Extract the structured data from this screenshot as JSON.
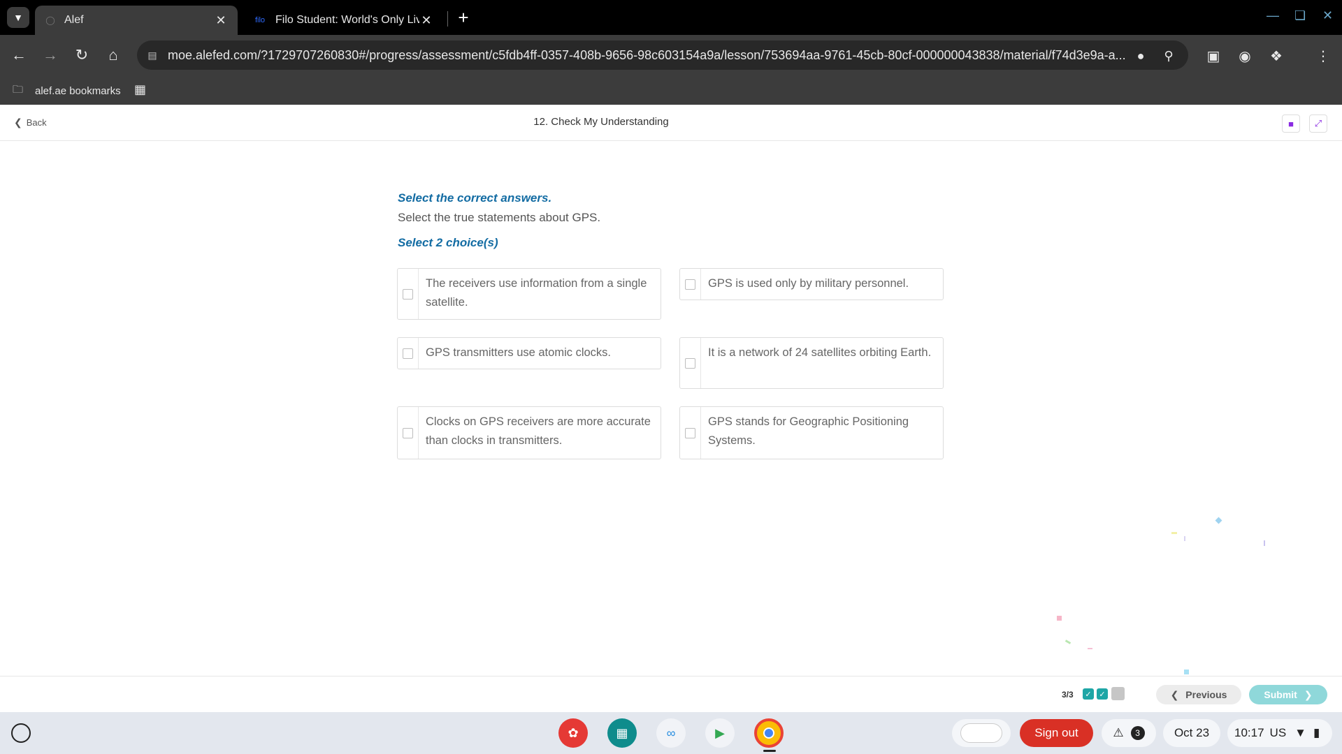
{
  "browser": {
    "tabs": [
      {
        "title": "Alef",
        "favicon": "alef-logo",
        "active": true
      },
      {
        "title": "Filo Student: World's Only Live I",
        "favicon_text": "filo",
        "active": false
      }
    ],
    "url": "moe.alefed.com/?1729707260830#/progress/assessment/c5fdb4ff-0357-408b-9656-98c603154a9a/lesson/753694aa-9761-45cb-80cf-000000043838/material/f74d3e9a-a...",
    "bookmark_folder": "alef.ae bookmarks"
  },
  "app": {
    "back_label": "Back",
    "title": "12. Check My Understanding"
  },
  "question": {
    "instruction": "Select the correct answers.",
    "prompt": "Select the true statements about GPS.",
    "select_count": "Select 2 choice(s)",
    "choices": [
      "The receivers use information from a single satellite.",
      "GPS is used only by military personnel.",
      "GPS transmitters use atomic clocks.",
      "It is a network of 24 satellites orbiting Earth.",
      "Clocks on GPS receivers are more accurate than clocks in transmitters.",
      "GPS stands for Geographic Positioning Systems."
    ]
  },
  "footer": {
    "progress": "3/3",
    "previous_label": "Previous",
    "submit_label": "Submit"
  },
  "shelf": {
    "signout_label": "Sign out",
    "notification_count": "3",
    "date": "Oct 23",
    "time": "10:17",
    "locale": "US"
  },
  "colors": {
    "accent_blue": "#136ca3",
    "submit_teal": "#8fd8da",
    "check_teal": "#1ea6a6",
    "signout_red": "#d93025"
  }
}
